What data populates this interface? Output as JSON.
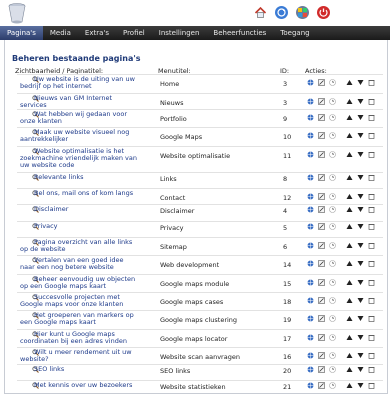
{
  "nav": {
    "tabs": [
      "Pagina's",
      "Media",
      "Extra's",
      "Profiel",
      "Instellingen",
      "Beheerfuncties",
      "Toegang"
    ]
  },
  "page_title": "Beheren bestaande pagina's",
  "table": {
    "headers": {
      "visibility": "Zichtbaarheid / Paginatitel:",
      "menu": "Menutitel:",
      "id": "ID:",
      "actions": "Acties:"
    },
    "rows": [
      {
        "title": "Uw website is de uiting van uw bedrijf op het internet",
        "menu": "Home",
        "id": "3"
      },
      {
        "title": "Nieuws van GM Internet services",
        "menu": "Nieuws",
        "id": "3"
      },
      {
        "title": "Wat hebben wij gedaan voor onze klanten",
        "menu": "Portfolio",
        "id": "9"
      },
      {
        "title": "Maak uw website visueel nog aantrekkelijker",
        "menu": "Google Maps",
        "id": "10"
      },
      {
        "title": "Website optimalisatie is het zoekmachine vriendelijk maken van uw website code",
        "menu": "Website optimalisatie",
        "id": "11"
      },
      {
        "title": "Relevante links",
        "menu": "Links",
        "id": "8"
      },
      {
        "title": "Bel ons, mail ons of kom langs",
        "menu": "Contact",
        "id": "12"
      },
      {
        "title": "Disclaimer",
        "menu": "Disclaimer",
        "id": "4"
      },
      {
        "title": "Privacy",
        "menu": "Privacy",
        "id": "5"
      },
      {
        "title": "Pagina overzicht van alle links op de website",
        "menu": "Sitemap",
        "id": "6"
      },
      {
        "title": "Vertalen van een goed idee naar een nog betere website",
        "menu": "Web development",
        "id": "14"
      },
      {
        "title": "Beheer eenvoudig uw objecten op een Google maps kaart",
        "menu": "Google maps module",
        "id": "15"
      },
      {
        "title": "Succesvolle projecten met Google maps voor onze klanten",
        "menu": "Google maps cases",
        "id": "18"
      },
      {
        "title": "Het groeperen van markers op een Google maps kaart",
        "menu": "Google maps clustering",
        "id": "19"
      },
      {
        "title": "Hier kunt u Google maps coordinaten bij een adres vinden",
        "menu": "Google maps locator",
        "id": "17"
      },
      {
        "title": "Wilt u meer rendement uit uw website?",
        "menu": "Website scan aanvragen",
        "id": "16"
      },
      {
        "title": "SEO links",
        "menu": "SEO links",
        "id": "20"
      },
      {
        "title": "Met kennis over uw bezoekers",
        "menu": "Website statistieken",
        "id": "21"
      }
    ]
  },
  "colors": {
    "nav_bg": "#1a1a1a",
    "active_tab": "#2c3d6b",
    "title": "#1f3a78",
    "link": "#1d3a8a"
  },
  "icons": {
    "header": [
      "home-icon",
      "refresh-icon",
      "settings-icon",
      "logout-icon"
    ],
    "row_actions": [
      "globe-icon",
      "edit-icon",
      "clock-icon",
      "up-arrow-icon",
      "down-arrow-icon",
      "delete-icon"
    ]
  }
}
